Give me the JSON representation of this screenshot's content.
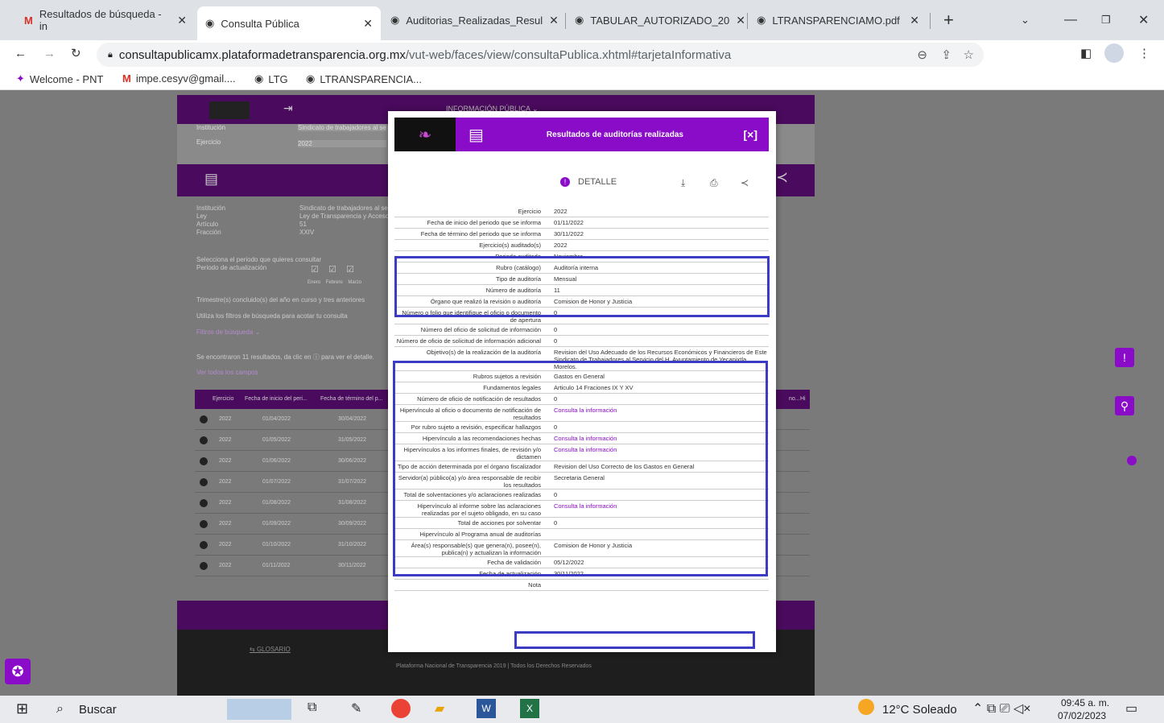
{
  "tabs": [
    {
      "label": "Resultados de búsqueda - in",
      "icon": "gmail-icon"
    },
    {
      "label": "Consulta Pública",
      "icon": "globe-icon"
    },
    {
      "label": "Auditorias_Realizadas_Resul",
      "icon": "globe-icon"
    },
    {
      "label": "TABULAR_AUTORIZADO_20",
      "icon": "globe-icon"
    },
    {
      "label": "LTRANSPARENCIAMO.pdf",
      "icon": "globe-icon"
    }
  ],
  "url": {
    "host": "consultapublicamx.plataformadetransparencia.org.mx",
    "path": "/vut-web/faces/view/consultaPublica.xhtml#tarjetaInformativa"
  },
  "bookmarks": [
    "Welcome - PNT",
    "impe.cesyv@gmail....",
    "LTG",
    "LTRANSPARENCIA..."
  ],
  "bg": {
    "menu": "INFORMACIÓN PÚBLICA ⌄",
    "inst_label": "Institución",
    "inst_value": "Sindicato de trabajadores al se",
    "ej_label": "Ejercicio",
    "ej_value": "2022",
    "info": [
      {
        "l": "Institución",
        "v": "Sindicato de trabajadores al se"
      },
      {
        "l": "Ley",
        "v": "Ley de Transparencia y Acceso..."
      },
      {
        "l": "Artículo",
        "v": "51"
      },
      {
        "l": "Fracción",
        "v": "XXIV"
      }
    ],
    "periodo_text": "Selecciona el periodo que quieres consultar",
    "periodo_label": "Periodo de actualización",
    "months": [
      "Enero",
      "Febrero",
      "Marzo"
    ],
    "trimestre": "Trimestre(s) concluido(s) del año en curso y tres anteriores",
    "filtros_text": "Utiliza los filtros de búsqueda para acotar tu consulta",
    "filtros_link": "Filtros de búsqueda ⌄",
    "found": "Se encontraron 11 resultados, da clic en",
    "found2": "para ver el detalle.",
    "ver_todos": "Ver todos los campos",
    "col_headers": [
      "Ejercicio",
      "Fecha de inicio del peri...",
      "Fecha de término del p..."
    ],
    "col_right": [
      "no...",
      "Hi"
    ],
    "rows": [
      [
        "2022",
        "01/04/2022",
        "30/04/2022"
      ],
      [
        "2022",
        "01/05/2022",
        "31/05/2022"
      ],
      [
        "2022",
        "01/06/2022",
        "30/06/2022"
      ],
      [
        "2022",
        "01/07/2022",
        "31/07/2022"
      ],
      [
        "2022",
        "01/08/2022",
        "31/08/2022"
      ],
      [
        "2022",
        "01/09/2022",
        "30/09/2022"
      ],
      [
        "2022",
        "01/10/2022",
        "31/10/2022"
      ],
      [
        "2022",
        "01/11/2022",
        "30/11/2022"
      ]
    ],
    "glosario": "GLOSARIO",
    "footer": "Plataforma Nacional de Transparencia 2019 | Todos los Derechos Reservados"
  },
  "modal": {
    "title": "Resultados de auditorías realizadas",
    "close": "[×]",
    "detalle": "DETALLE",
    "fields": [
      {
        "l": "Ejercicio",
        "v": "2022"
      },
      {
        "l": "Fecha de inicio del periodo que se informa",
        "v": "01/11/2022"
      },
      {
        "l": "Fecha de término del periodo que se informa",
        "v": "30/11/2022"
      },
      {
        "l": "Ejercicio(s) auditado(s)",
        "v": "2022"
      },
      {
        "l": "Periodo auditado",
        "v": "Noviembre"
      },
      {
        "l": "Rubro (catálogo)",
        "v": "Auditoría interna"
      },
      {
        "l": "Tipo de auditoría",
        "v": "Mensual"
      },
      {
        "l": "Número de auditoría",
        "v": "11"
      },
      {
        "l": "Órgano que realizó la revisión o auditoría",
        "v": "Comision de Honor y Justicia"
      },
      {
        "l": "Número o folio que identifique el oficio o documento de apertura",
        "v": "0"
      },
      {
        "l": "Número del oficio de solicitud de información",
        "v": "0"
      },
      {
        "l": "Número de oficio de solicitud de información adicional",
        "v": "0"
      },
      {
        "l": "Objetivo(s) de la realización de la auditoría",
        "v": "Revision del Uso Adecuado de los Recursos Económicos y Financieros de Este Sindicato de Trabajadores al Servicio del H. Ayuntamiento de Yecapixtla, Morelos."
      },
      {
        "l": "Rubros sujetos a revisión",
        "v": "Gastos en General"
      },
      {
        "l": "Fundamentos legales",
        "v": "Articulo 14 Fraciones IX Y XV"
      },
      {
        "l": "Número de oficio de notificación de resultados",
        "v": "0"
      },
      {
        "l": "Hipervínculo al oficio o documento de notificación de resultados",
        "v": "Consulta la información",
        "link": true
      },
      {
        "l": "Por rubro sujeto a revisión, especificar hallazgos",
        "v": "0"
      },
      {
        "l": "Hipervínculo a las recomendaciones hechas",
        "v": "Consulta la información",
        "link": true
      },
      {
        "l": "Hipervínculos a los informes finales, de revisión y/o dictamen",
        "v": "Consulta la información",
        "link": true
      },
      {
        "l": "Tipo de acción determinada por el órgano fiscalizador",
        "v": "Revision del Uso Correcto de los Gastos en General"
      },
      {
        "l": "Servidor(a) público(a) y/o área responsable de recibir los resultados",
        "v": "Secretaria General"
      },
      {
        "l": "Total de solventaciones y/o aclaraciones realizadas",
        "v": "0"
      },
      {
        "l": "Hipervínculo al informe sobre las aclaraciones realizadas por el sujeto obligado, en su caso",
        "v": "Consulta la información",
        "link": true
      },
      {
        "l": "Total de acciones por solventar",
        "v": "0"
      },
      {
        "l": "Hipervínculo al Programa anual de auditorías",
        "v": ""
      },
      {
        "l": "Área(s) responsable(s) que genera(n), posee(n), publica(n) y actualizan la información",
        "v": "Comision de Honor y Justicia"
      },
      {
        "l": "Fecha de validación",
        "v": "05/12/2022"
      },
      {
        "l": "Fecha de actualización",
        "v": "30/11/2022"
      },
      {
        "l": "Nota",
        "v": ""
      }
    ]
  },
  "taskbar": {
    "search": "Buscar",
    "weather": "12°C Soleado",
    "time": "09:45 a. m.",
    "date": "07/02/2023"
  }
}
